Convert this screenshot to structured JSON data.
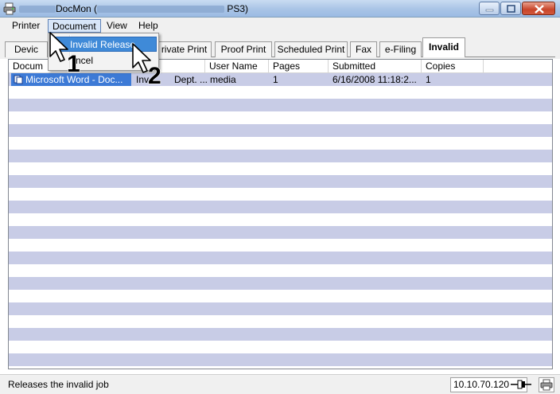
{
  "window": {
    "title_suffix": "DocMon (",
    "title_tail": " PS3)"
  },
  "menubar": {
    "items": [
      "Printer",
      "Document",
      "View",
      "Help"
    ]
  },
  "tabs": [
    "Devic",
    "rivate Print",
    "Proof Print",
    "Scheduled Print",
    "Fax",
    "e-Filing",
    "Invalid"
  ],
  "active_tab": "Invalid",
  "dropdown": {
    "items": [
      "Invalid Release",
      "Cancel"
    ],
    "cancel_visible": "ncel"
  },
  "list": {
    "columns": [
      "Docum",
      "User Name",
      "Pages",
      "Submitted",
      "Copies"
    ],
    "rows": [
      {
        "document": "Microsoft Word - Doc...",
        "department": "Inv",
        "department_tail": "Dept. ...",
        "user_name": "media",
        "pages": "1",
        "submitted": "6/16/2008 11:18:2...",
        "copies": "1"
      }
    ]
  },
  "callouts": {
    "step1": "1",
    "step2": "2"
  },
  "status": {
    "message": "Releases the invalid job",
    "ip_address": "10.10.70.120"
  },
  "colors": {
    "selection": "#3d7ad6",
    "row_stripe": "#c8cce6",
    "menu_highlight": "#3f8ad8"
  }
}
